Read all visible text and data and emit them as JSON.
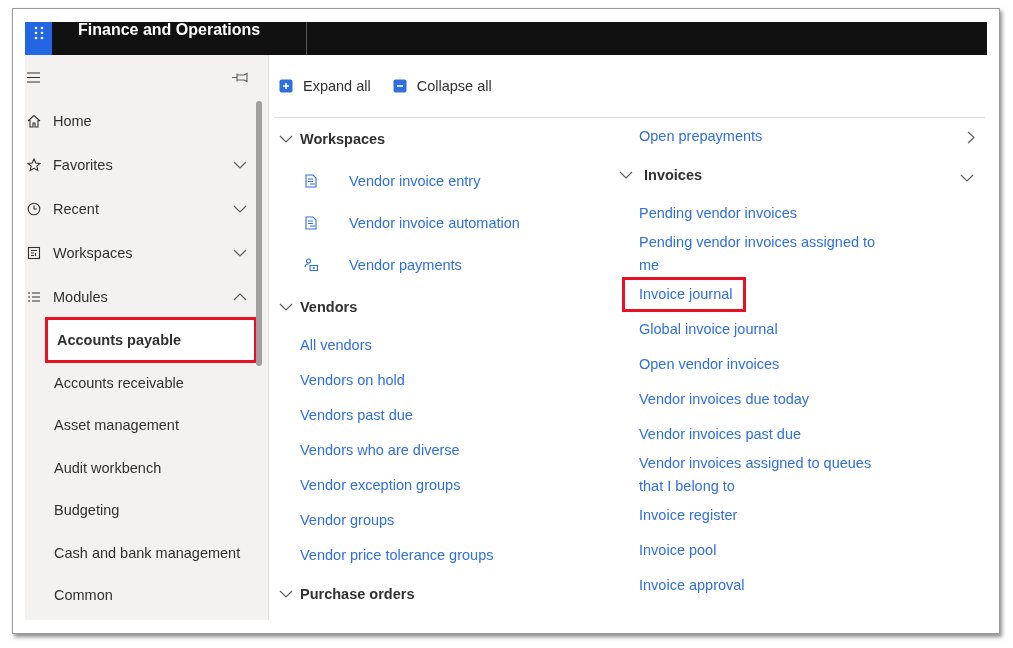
{
  "app": {
    "title": "Finance and Operations"
  },
  "nav": {
    "items": [
      {
        "label": "Home",
        "kind": "home"
      },
      {
        "label": "Favorites",
        "kind": "favorites",
        "expanded": false
      },
      {
        "label": "Recent",
        "kind": "recent",
        "expanded": false
      },
      {
        "label": "Workspaces",
        "kind": "workspaces",
        "expanded": false
      },
      {
        "label": "Modules",
        "kind": "modules",
        "expanded": true,
        "children": [
          {
            "label": "Accounts payable",
            "selected": true,
            "highlighted": true
          },
          {
            "label": "Accounts receivable",
            "selected": false,
            "highlighted": false
          },
          {
            "label": "Asset management",
            "selected": false,
            "highlighted": false
          },
          {
            "label": "Audit workbench",
            "selected": false,
            "highlighted": false
          },
          {
            "label": "Budgeting",
            "selected": false,
            "highlighted": false
          },
          {
            "label": "Cash and bank management",
            "selected": false,
            "highlighted": false
          },
          {
            "label": "Common",
            "selected": false,
            "highlighted": false
          }
        ]
      }
    ]
  },
  "toolbar": [
    {
      "label": "Expand all",
      "kind": "expand"
    },
    {
      "label": "Collapse all",
      "kind": "collapse"
    }
  ],
  "columns": [
    [
      {
        "title": "Workspaces",
        "expanded": true,
        "links": [
          {
            "label": "Vendor invoice entry",
            "kind": "invoice",
            "highlighted": false
          },
          {
            "label": "Vendor invoice automation",
            "kind": "invoice",
            "highlighted": false
          },
          {
            "label": "Vendor payments",
            "kind": "payment",
            "highlighted": false
          }
        ]
      },
      {
        "title": "Vendors",
        "expanded": true,
        "links": [
          {
            "label": "All vendors",
            "highlighted": false
          },
          {
            "label": "Vendors on hold",
            "highlighted": false
          },
          {
            "label": "Vendors past due",
            "highlighted": false
          },
          {
            "label": "Vendors who are diverse",
            "highlighted": false
          },
          {
            "label": "Vendor exception groups",
            "highlighted": false
          },
          {
            "label": "Vendor groups",
            "highlighted": false
          },
          {
            "label": "Vendor price tolerance groups",
            "highlighted": false
          }
        ]
      },
      {
        "title": "Purchase orders",
        "expanded": true
      }
    ],
    [
      {
        "links": [
          {
            "label": "Open prepayments",
            "highlighted": false
          }
        ]
      },
      {
        "title": "Invoices",
        "expanded": true,
        "links": [
          {
            "label": "Pending vendor invoices",
            "highlighted": false
          },
          {
            "label": "Pending vendor invoices assigned to me",
            "highlighted": false
          },
          {
            "label": "Invoice journal",
            "highlighted": true
          },
          {
            "label": "Global invoice journal",
            "highlighted": false
          },
          {
            "label": "Open vendor invoices",
            "highlighted": false
          },
          {
            "label": "Vendor invoices due today",
            "highlighted": false
          },
          {
            "label": "Vendor invoices past due",
            "highlighted": false
          },
          {
            "label": "Vendor invoices assigned to queues that I belong to",
            "highlighted": false
          },
          {
            "label": "Invoice register",
            "highlighted": false
          },
          {
            "label": "Invoice pool",
            "highlighted": false
          },
          {
            "label": "Invoice approval",
            "highlighted": false
          }
        ]
      }
    ]
  ]
}
